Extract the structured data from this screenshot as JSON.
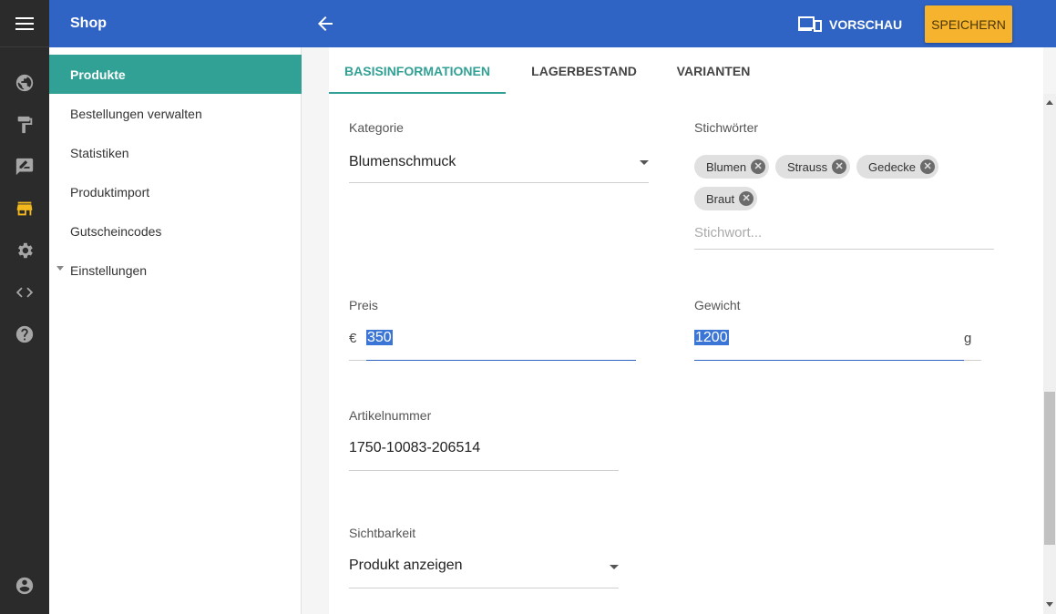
{
  "sidebar": {
    "title": "Shop",
    "items": [
      {
        "label": "Produkte"
      },
      {
        "label": "Bestellungen verwalten"
      },
      {
        "label": "Statistiken"
      },
      {
        "label": "Produktimport"
      },
      {
        "label": "Gutscheincodes"
      },
      {
        "label": "Einstellungen"
      }
    ]
  },
  "rail": {
    "icons": [
      "menu-icon",
      "globe-icon",
      "paint-roller-icon",
      "edit-note-icon",
      "store-icon",
      "gear-icon",
      "code-icon",
      "help-icon",
      "account-icon"
    ],
    "active_color": "#f3b81c"
  },
  "topbar": {
    "preview_label": "VORSCHAU",
    "save_label": "SPEICHERN",
    "color": "#2f63c4",
    "save_color": "#f6b42e"
  },
  "tabs": [
    {
      "label": "BASISINFORMATIONEN"
    },
    {
      "label": "LAGERBESTAND"
    },
    {
      "label": "VARIANTEN"
    }
  ],
  "form": {
    "kategorie": {
      "label": "Kategorie",
      "value": "Blumenschmuck"
    },
    "stichwoerter": {
      "label": "Stichwörter",
      "chips": [
        "Blumen",
        "Strauss",
        "Gedecke",
        "Braut"
      ],
      "placeholder": "Stichwort..."
    },
    "preis": {
      "label": "Preis",
      "prefix": "€",
      "value": "350"
    },
    "gewicht": {
      "label": "Gewicht",
      "value": "1200",
      "suffix": "g"
    },
    "artikelnummer": {
      "label": "Artikelnummer",
      "value": "1750-10083-206514"
    },
    "sichtbarkeit": {
      "label": "Sichtbarkeit",
      "value": "Produkt anzeigen"
    }
  },
  "accent_color": "#32a195"
}
